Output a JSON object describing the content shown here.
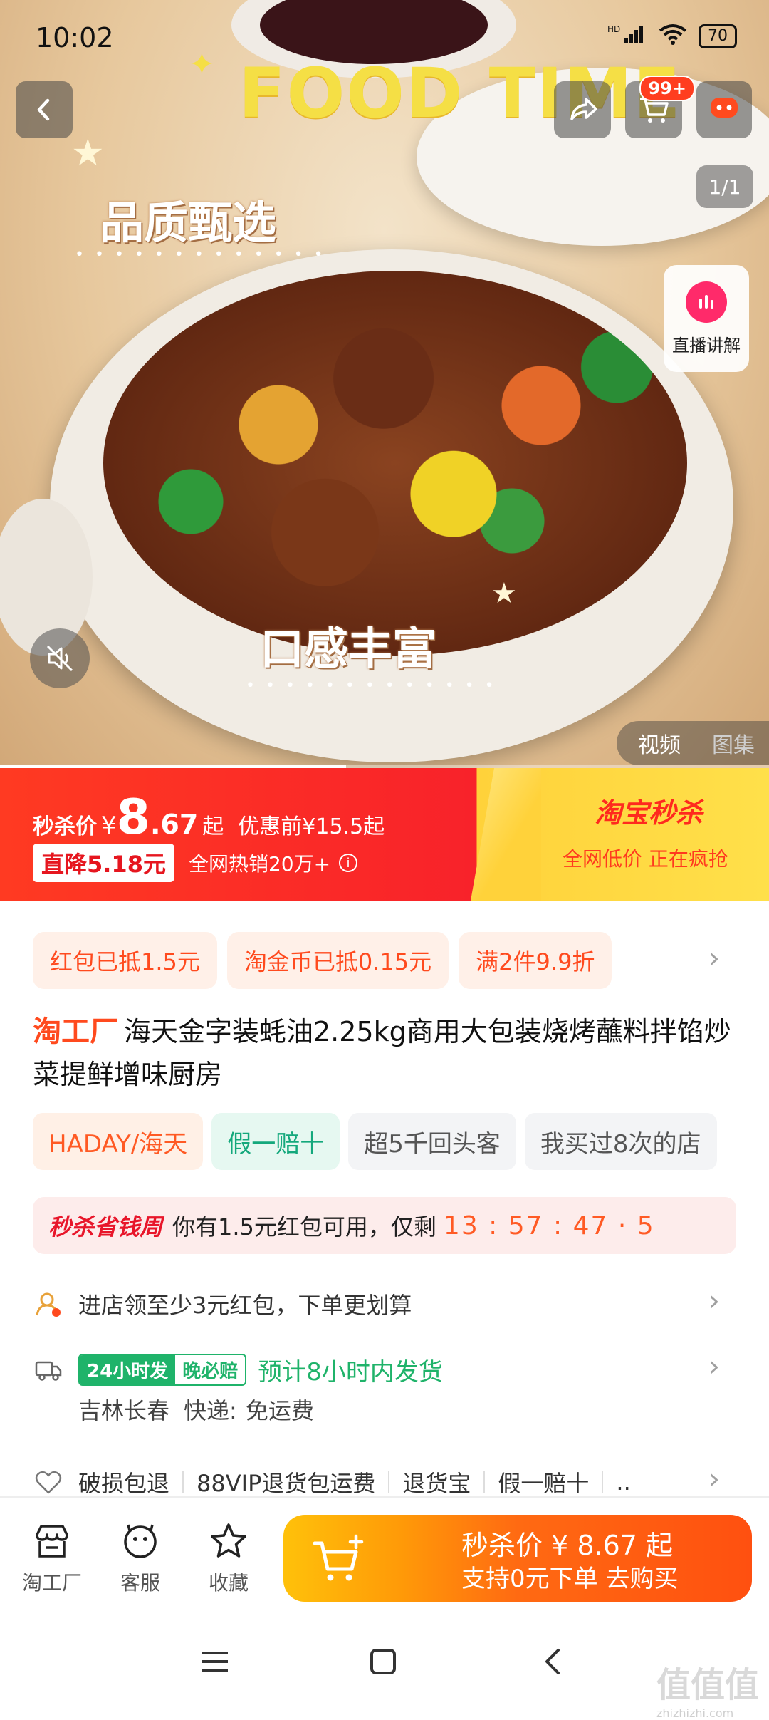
{
  "status_bar": {
    "time": "10:02",
    "signal": "HD",
    "battery": "70"
  },
  "hero": {
    "title_en": "FOOD TIME",
    "tag_quality": "品质甄选",
    "tag_taste": "口感丰富",
    "counter": "1/1",
    "live_label": "直播讲解",
    "media_tabs": [
      "视频",
      "图集"
    ]
  },
  "header": {
    "cart_badge": "99+"
  },
  "price_banner": {
    "label": "秒杀价",
    "currency": "¥",
    "price_int": "8",
    "price_dec": ".67",
    "suffix": "起",
    "original": "优惠前¥15.5起",
    "drop": "直降5.18元",
    "sales": "全网热销20万+",
    "brand": "淘宝秒杀",
    "brand_sub": "全网低价 正在疯抢"
  },
  "coupons": [
    "红包已抵1.5元",
    "淘金币已抵0.15元",
    "满2件9.9折"
  ],
  "product": {
    "shop_tag": "淘工厂",
    "title": "海天金字装蚝油2.25kg商用大包装烧烤蘸料拌馅炒菜提鲜增味厨房"
  },
  "tags": [
    "HADAY/海天",
    "假一赔十",
    "超5千回头客",
    "我买过8次的店"
  ],
  "promo": {
    "tag": "秒杀省钱周",
    "text": "你有1.5元红包可用，仅剩",
    "timer": "13 : 57 : 47 · 5"
  },
  "shop_coupon": {
    "text": "进店领至少3元红包，下单更划算"
  },
  "shipping": {
    "badge_a": "24小时发",
    "badge_b": "晚必赔",
    "text": "预计8小时内发货",
    "location": "吉林长春",
    "express": "快递:",
    "fee": "免运费"
  },
  "services": [
    "破损包退",
    "88VIP退货包运费",
    "退货宝",
    "假一赔十",
    ".."
  ],
  "bottom_bar": {
    "shop": "淘工厂",
    "service": "客服",
    "favorite": "收藏",
    "buy_line1": "秒杀价 ¥ 8.67 起",
    "buy_line2": "支持0元下单  去购买"
  },
  "watermark": {
    "big": "值值值",
    "small": "zhizhizhi.com"
  },
  "colors": {
    "accent": "#ff4a1e",
    "banner_red": "#f8222a",
    "banner_yellow": "#ffd23a",
    "green": "#1fb36a"
  }
}
